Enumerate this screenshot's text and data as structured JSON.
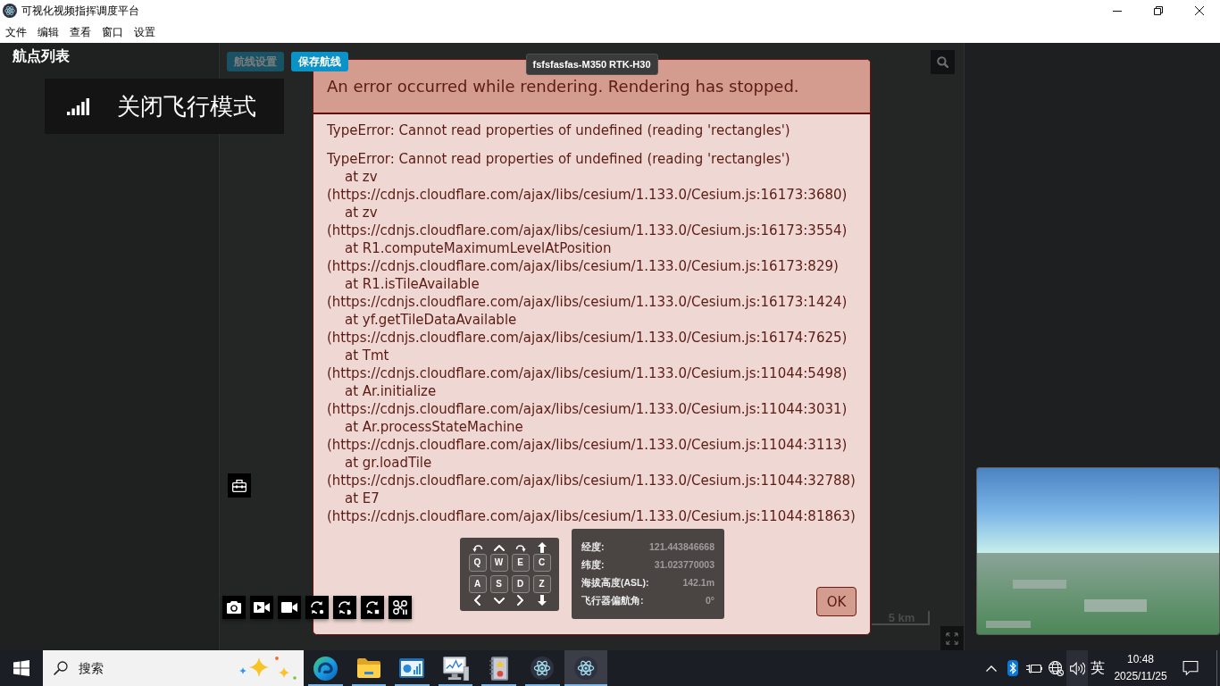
{
  "window": {
    "title": "可视化视频指挥调度平台"
  },
  "menu": [
    "文件",
    "编辑",
    "查看",
    "窗口",
    "设置"
  ],
  "sidebar": {
    "title": "航点列表"
  },
  "toast": {
    "text": "关闭飞行模式"
  },
  "map": {
    "route_buttons": [
      {
        "label": "航线设置",
        "disabled": true
      },
      {
        "label": "保存航线",
        "disabled": false
      }
    ],
    "drone_label": "fsfsfasfas-M350 RTK-H30",
    "keyboard": {
      "upper_keys": [
        "Q",
        "W",
        "E",
        "C"
      ],
      "lower_keys": [
        "A",
        "S",
        "D",
        "Z"
      ]
    },
    "telemetry": [
      {
        "label": "经度:",
        "value": "121.443846668"
      },
      {
        "label": "纬度:",
        "value": "31.023770003"
      },
      {
        "label": "海拔高度(ASL):",
        "value": "142.1m"
      },
      {
        "label": "飞行器偏航角:",
        "value": "0°"
      }
    ],
    "scale": "5 km"
  },
  "error_dialog": {
    "title": "An error occurred while rendering. Rendering has stopped.",
    "message": "TypeError: Cannot read properties of undefined (reading 'rectangles')",
    "stack_title": "TypeError: Cannot read properties of undefined (reading 'rectangles')",
    "stack": [
      "at zv (https://cdnjs.cloudflare.com/ajax/libs/cesium/1.133.0/Cesium.js:16173:3680)",
      "at zv (https://cdnjs.cloudflare.com/ajax/libs/cesium/1.133.0/Cesium.js:16173:3554)",
      "at R1.computeMaximumLevelAtPosition (https://cdnjs.cloudflare.com/ajax/libs/cesium/1.133.0/Cesium.js:16173:829)",
      "at R1.isTileAvailable (https://cdnjs.cloudflare.com/ajax/libs/cesium/1.133.0/Cesium.js:16173:1424)",
      "at yf.getTileDataAvailable (https://cdnjs.cloudflare.com/ajax/libs/cesium/1.133.0/Cesium.js:16174:7625)",
      "at Tmt (https://cdnjs.cloudflare.com/ajax/libs/cesium/1.133.0/Cesium.js:11044:5498)",
      "at Ar.initialize (https://cdnjs.cloudflare.com/ajax/libs/cesium/1.133.0/Cesium.js:11044:3031)",
      "at Ar.processStateMachine (https://cdnjs.cloudflare.com/ajax/libs/cesium/1.133.0/Cesium.js:11044:3113)",
      "at gr.loadTile (https://cdnjs.cloudflare.com/ajax/libs/cesium/1.133.0/Cesium.js:11044:32788)",
      "at E7 (https://cdnjs.cloudflare.com/ajax/libs/cesium/1.133.0/Cesium.js:11044:81863)"
    ],
    "button": "OK"
  },
  "taskbar": {
    "search": {
      "placeholder": "搜索"
    },
    "apps": [
      {
        "running": true,
        "selected": false
      },
      {
        "running": true,
        "selected": false
      },
      {
        "running": true,
        "selected": false
      },
      {
        "running": true,
        "selected": false
      },
      {
        "running": true,
        "selected": false
      },
      {
        "running": true,
        "selected": false
      },
      {
        "running": true,
        "selected": true
      }
    ],
    "tray": {
      "volume_highlighted": true,
      "input_method": "英",
      "time": "10:48",
      "date": "2025/11/25"
    }
  }
}
